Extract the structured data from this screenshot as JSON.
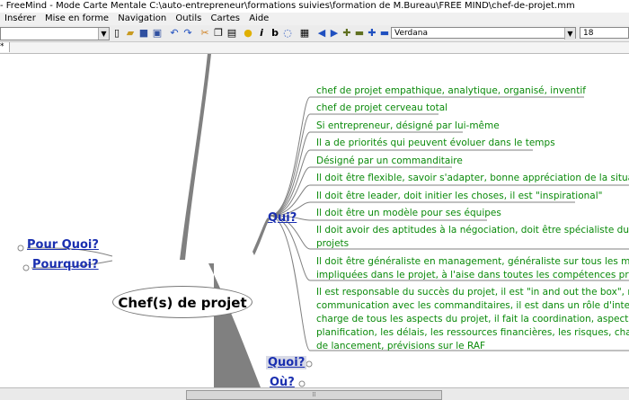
{
  "titlebar": {
    "text": "- FreeMind - Mode Carte Mentale C:\\auto-entrepreneur\\formations suivies\\formation de M.Bureau\\FREE MIND\\chef-de-projet.mm"
  },
  "menu": [
    "Insérer",
    "Mise en forme",
    "Navigation",
    "Outils",
    "Cartes",
    "Aide"
  ],
  "toolbar": {
    "font": "Verdana",
    "size": "18",
    "tab_label": "*"
  },
  "map": {
    "root": "Chef(s) de projet",
    "left_branches": [
      "Pour Quoi?",
      "Pourquoi?"
    ],
    "qui": {
      "label": "Qui?",
      "leaves": [
        [
          "chef de projet empathique, analytique, organisé, inventif"
        ],
        [
          "chef de projet cerveau total"
        ],
        [
          "Si entrepreneur, désigné par lui-même"
        ],
        [
          "Il a de priorités qui peuvent évoluer dans le temps"
        ],
        [
          "Désigné par un commanditaire"
        ],
        [
          "Il doit être flexible, savoir s'adapter, bonne appréciation de la situation"
        ],
        [
          "Il doit être leader, doit initier les choses, il est \"inspirational\""
        ],
        [
          "Il doit être un modèle pour ses équipes"
        ],
        [
          "Il doit avoir des aptitudes à la négociation, doit être spécialiste du manag",
          "projets"
        ],
        [
          "Il doit être généraliste en management, généraliste sur tous les métiers d",
          "impliquées dans le projet, à l'aise dans toutes les compétences projet"
        ],
        [
          "Il est responsable du succès du projet, il est \"in and out the box\", respons",
          "communication avec les commanditaires, il est dans un rôle d'interface, i",
          "charge de tous les aspects du projet, il fait la coordination, aspects coord",
          "planification, les délais, les ressources financières, les risques, chargé d",
          "de lancement, prévisions sur le RAF"
        ]
      ]
    },
    "quoi": "Quoi?",
    "ou": "Où?"
  },
  "colors": {
    "leaf": "#0a8a0a",
    "branch": "#1a2fb0",
    "edge": "#808080"
  },
  "icons": [
    "new-icon",
    "open-icon",
    "save-icon",
    "save-as-icon",
    "undo-icon",
    "redo-icon",
    "cut-icon",
    "copy-icon",
    "paste-icon",
    "idea-icon",
    "italic-icon",
    "bold-icon",
    "bubble-icon",
    "grid-icon",
    "back-icon",
    "forward-icon",
    "expand-icon",
    "collapse-icon",
    "add-icon",
    "remove-icon"
  ]
}
